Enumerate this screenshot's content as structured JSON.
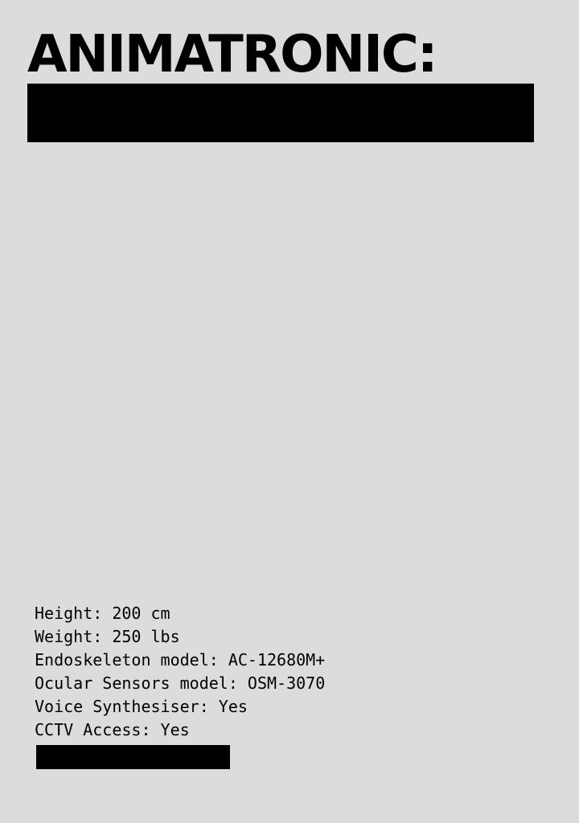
{
  "header": {
    "title": "ANIMATRONIC:"
  },
  "specs": {
    "height": "Height: 200 cm",
    "weight": "Weight: 250 lbs",
    "endoskeleton": "Endoskeleton model: AC-12680M+",
    "ocular": "Ocular Sensors model: OSM-3070",
    "voice": "Voice Synthesiser: Yes",
    "cctv": "CCTV Access: Yes"
  },
  "colors": {
    "background": "#dcdcdc",
    "text": "#000000",
    "redaction": "#000000"
  }
}
